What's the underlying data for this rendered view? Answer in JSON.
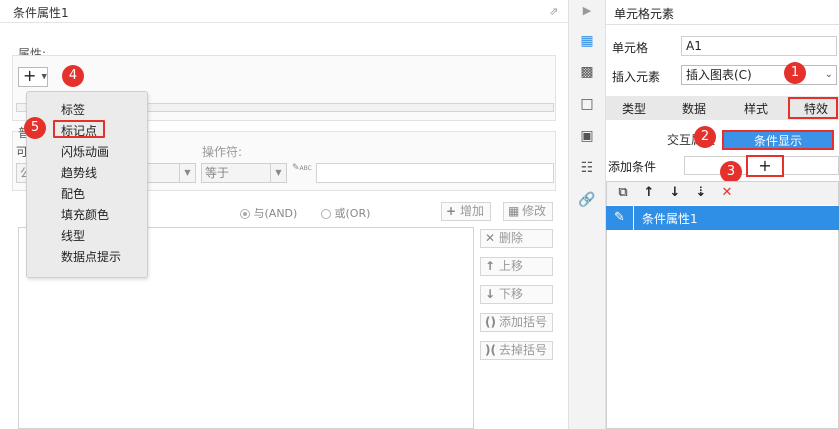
{
  "left_dialog": {
    "title": "条件属性1",
    "property_label": "属性:",
    "add_button_label": "+",
    "menu_items": [
      "标签",
      "标记点",
      "闪烁动画",
      "趋势线",
      "配色",
      "填充颜色",
      "线型",
      "数据点提示"
    ],
    "partial_label_1": "普",
    "partial_label_2": "可",
    "partial_value": "公",
    "operator_label": "操作符:",
    "operator_value": "等于",
    "radio_and": "与(AND)",
    "radio_or": "或(OR)",
    "add_btn": "增加",
    "modify_btn": "修改",
    "delete_btn": "删除",
    "up_btn": "上移",
    "down_btn": "下移",
    "add_bracket_btn": "添加括号",
    "remove_bracket_btn": "去掉括号"
  },
  "badges": {
    "b1": "1",
    "b2": "2",
    "b3": "3",
    "b4": "4",
    "b5": "5"
  },
  "right_panel": {
    "title": "单元格元素",
    "cell_label": "单元格",
    "cell_value": "A1",
    "insert_label": "插入元素",
    "insert_value": "插入图表(C)",
    "tabs": [
      "类型",
      "数据",
      "样式",
      "特效"
    ],
    "sub_tab_interactive": "交互属性",
    "sub_tab_condition": "条件显示",
    "add_condition_label": "添加条件",
    "add_plus": "+",
    "list_row": "条件属性1"
  },
  "colors": {
    "accent_blue": "#2f8fe6",
    "callout_red": "#e5312c"
  }
}
